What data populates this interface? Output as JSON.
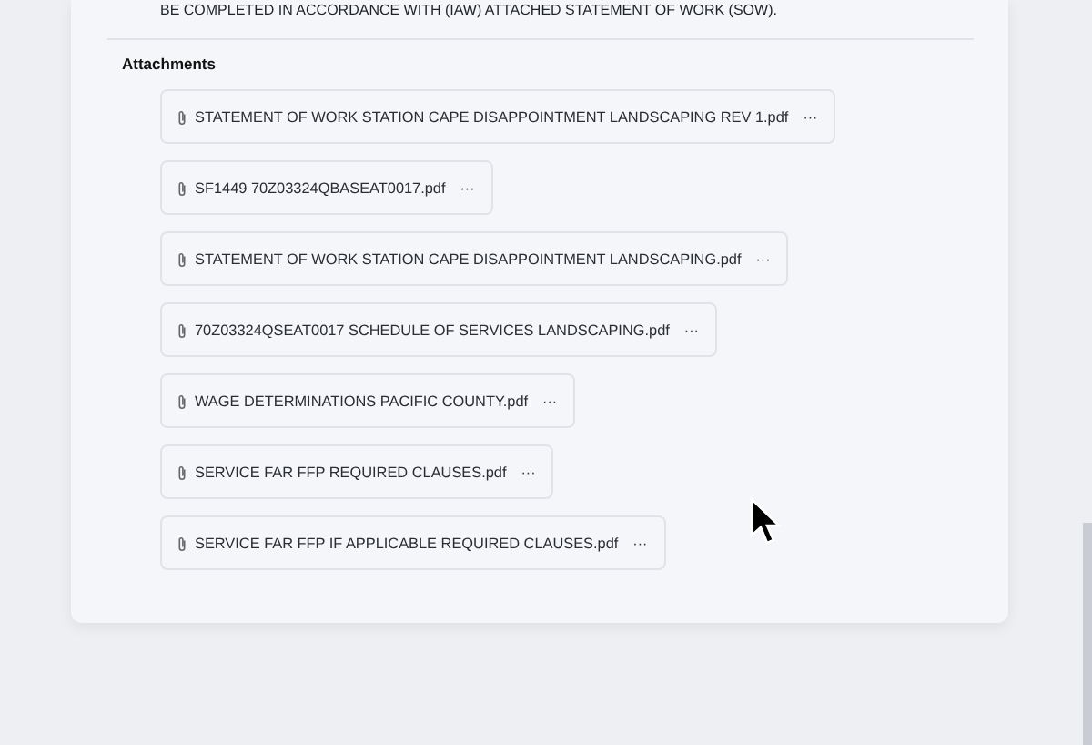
{
  "description_tail": "BE COMPLETED IN ACCORDANCE WITH (IAW) ATTACHED STATEMENT OF WORK (SOW).",
  "attachments": {
    "heading": "Attachments",
    "files": [
      {
        "name": "STATEMENT OF WORK STATION CAPE DISAPPOINTMENT LANDSCAPING REV 1.pdf",
        "menu": "···"
      },
      {
        "name": "SF1449 70Z03324QBASEAT0017.pdf",
        "menu": "···"
      },
      {
        "name": "STATEMENT OF WORK STATION CAPE DISAPPOINTMENT LANDSCAPING.pdf",
        "menu": "···"
      },
      {
        "name": "70Z03324QSEAT0017 SCHEDULE OF SERVICES LANDSCAPING.pdf",
        "menu": "···"
      },
      {
        "name": "WAGE DETERMINATIONS PACIFIC COUNTY.pdf",
        "menu": "···"
      },
      {
        "name": "SERVICE FAR FFP REQUIRED CLAUSES.pdf",
        "menu": "···"
      },
      {
        "name": "SERVICE FAR FFP IF APPLICABLE REQUIRED CLAUSES.pdf",
        "menu": "···"
      }
    ]
  }
}
